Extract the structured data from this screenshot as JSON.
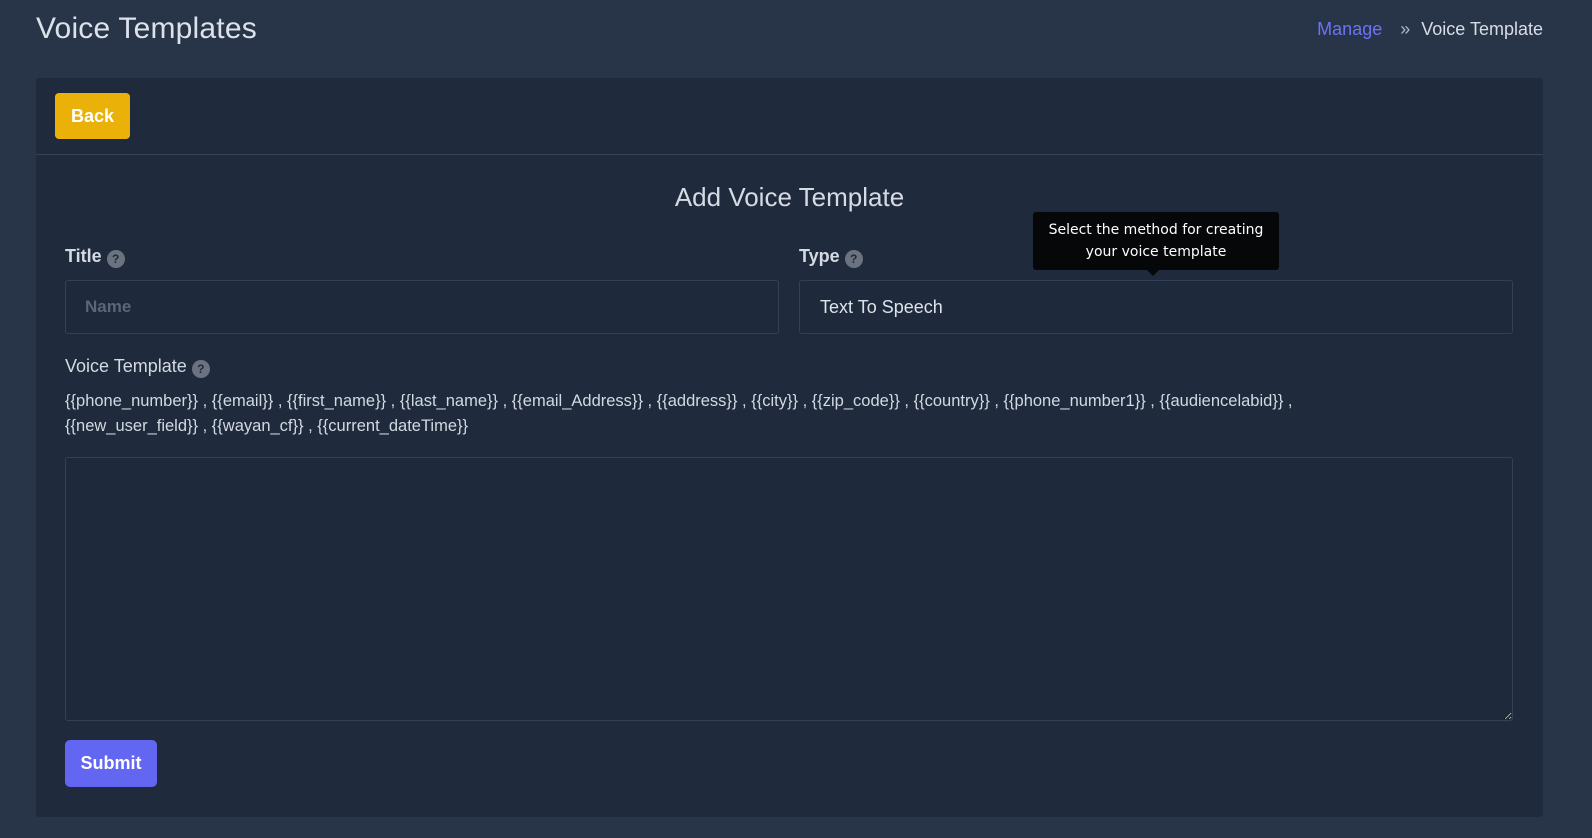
{
  "header": {
    "title": "Voice Templates",
    "breadcrumb": {
      "link_label": "Manage",
      "separator": "»",
      "current": "Voice Template"
    }
  },
  "card": {
    "back_label": "Back",
    "form_title": "Add Voice Template",
    "title_field": {
      "label": "Title",
      "placeholder": "Name",
      "value": ""
    },
    "type_field": {
      "label": "Type",
      "selected": "Text To Speech",
      "tooltip": "Select the method for creating your voice template"
    },
    "voice_template": {
      "label": "Voice Template",
      "variables": "{{phone_number}} , {{email}} , {{first_name}} , {{last_name}} , {{email_Address}} , {{address}} , {{city}} , {{zip_code}} , {{country}} , {{phone_number1}} , {{audiencelabid}} , {{new_user_field}} , {{wayan_cf}} , {{current_dateTime}}",
      "value": ""
    },
    "submit_label": "Submit",
    "help_glyph": "?"
  },
  "colors": {
    "background": "#283548",
    "card": "#1f2a3c",
    "back_button": "#eab208",
    "submit_button": "#6366f1",
    "link": "#6d72f6",
    "tooltip": "#050709"
  },
  "icons": {
    "help": "question-circle-icon",
    "separator": "double-chevron-right-icon",
    "resize": "resize-handle-icon"
  }
}
